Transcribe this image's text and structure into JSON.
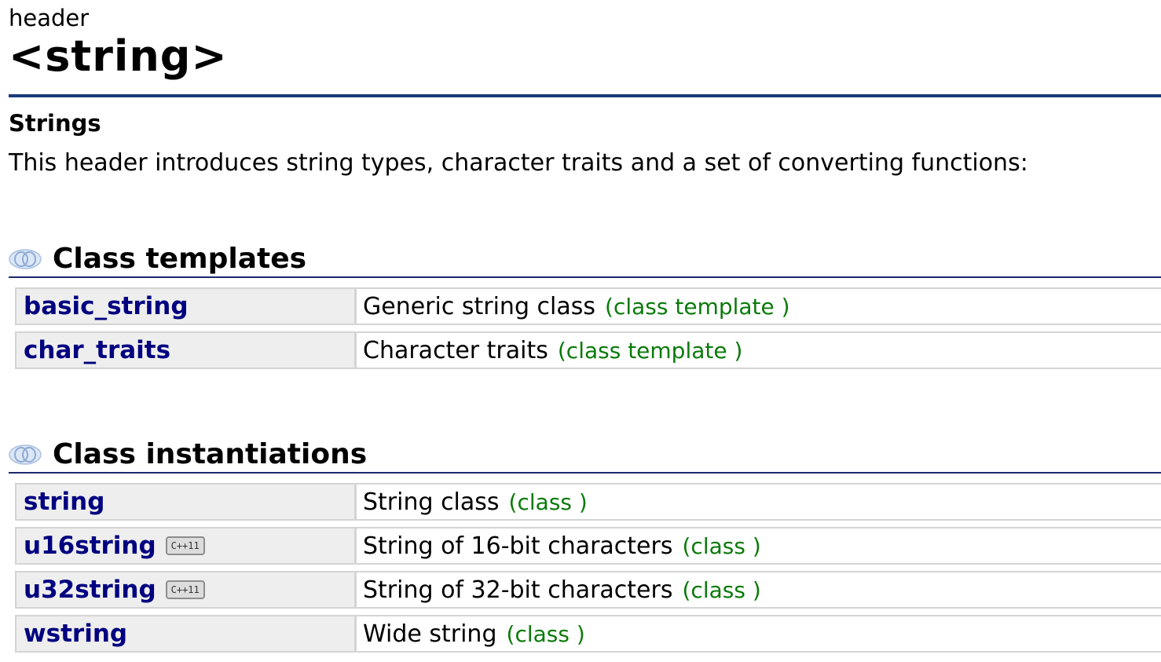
{
  "header": {
    "kind": "header",
    "title": "<string>"
  },
  "intro": {
    "subtitle": "Strings",
    "text": "This header introduces string types, character traits and a set of converting functions:"
  },
  "sections": [
    {
      "title": "Class templates",
      "icon": "class-group-icon",
      "rows": [
        {
          "name": "basic_string",
          "badge": "",
          "desc": "Generic string class",
          "kind": "class template"
        },
        {
          "name": "char_traits",
          "badge": "",
          "desc": "Character traits",
          "kind": "class template"
        }
      ]
    },
    {
      "title": "Class instantiations",
      "icon": "class-group-icon",
      "rows": [
        {
          "name": "string",
          "badge": "",
          "desc": "String class",
          "kind": "class"
        },
        {
          "name": "u16string",
          "badge": "C++11",
          "desc": "String of 16-bit characters",
          "kind": "class"
        },
        {
          "name": "u32string",
          "badge": "C++11",
          "desc": "String of 32-bit characters",
          "kind": "class"
        },
        {
          "name": "wstring",
          "badge": "",
          "desc": "Wide string",
          "kind": "class"
        }
      ]
    }
  ],
  "colors": {
    "rule": "#1b3a7a",
    "link": "#000080",
    "kind": "#0a7a0a",
    "cell_bg": "#eeeeee",
    "cell_border": "#d4d4d4"
  }
}
